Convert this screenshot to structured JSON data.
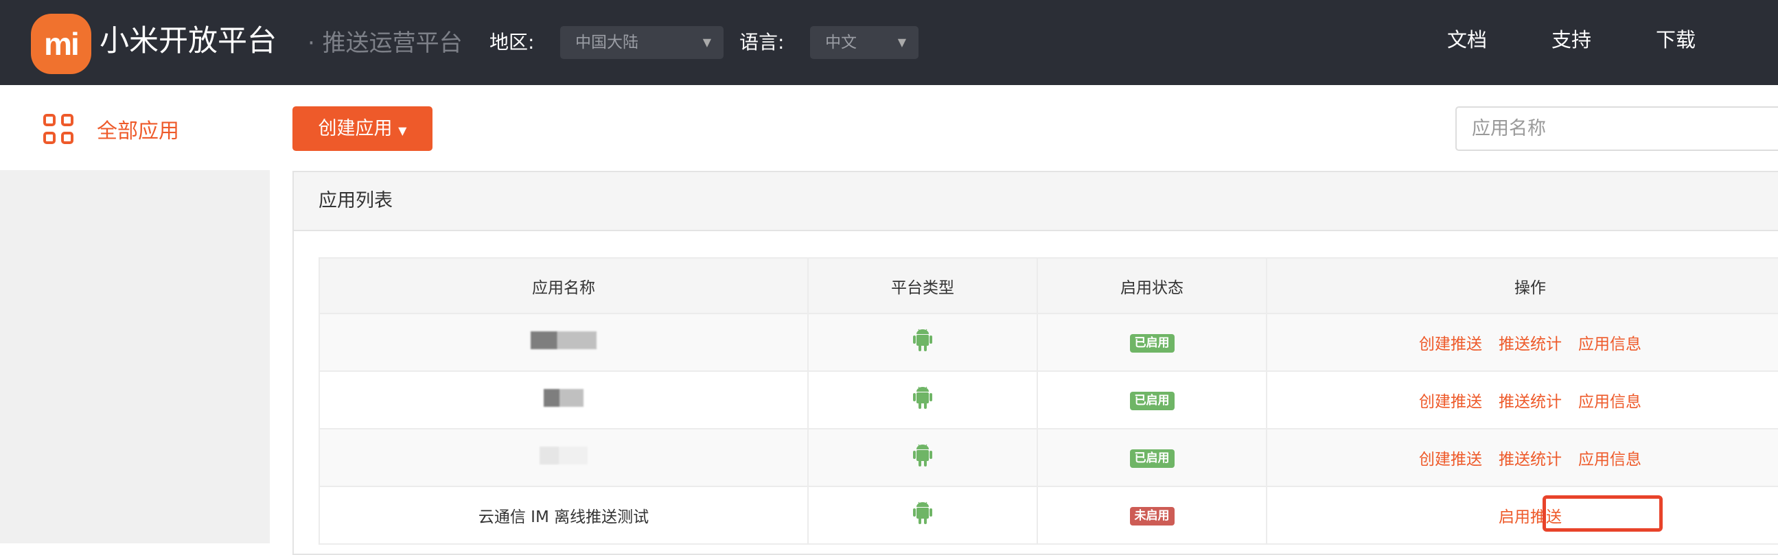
{
  "header": {
    "logo_text": "mi",
    "brand": "小米开放平台",
    "subtitle": "· 推送运营平台",
    "region_label": "地区:",
    "region_value": "中国大陆",
    "language_label": "语言:",
    "language_value": "中文",
    "nav": [
      "文档",
      "支持",
      "下载"
    ]
  },
  "sidebar": {
    "items": [
      {
        "label": "全部应用",
        "icon": "grid-icon",
        "active": true
      }
    ]
  },
  "toolbar": {
    "create_label": "创建应用",
    "search_placeholder": "应用名称"
  },
  "panel": {
    "title": "应用列表"
  },
  "table": {
    "columns": [
      "应用名称",
      "平台类型",
      "启用状态",
      "操作"
    ],
    "rows": [
      {
        "name": "",
        "redacted": true,
        "platform": "android",
        "status": "已启用",
        "actions": [
          "创建推送",
          "推送统计",
          "应用信息"
        ]
      },
      {
        "name": "",
        "redacted": true,
        "platform": "android",
        "status": "已启用",
        "actions": [
          "创建推送",
          "推送统计",
          "应用信息"
        ]
      },
      {
        "name": "",
        "redacted": true,
        "platform": "android",
        "status": "已启用",
        "actions": [
          "创建推送",
          "推送统计",
          "应用信息"
        ]
      },
      {
        "name": "云通信 IM 离线推送测试",
        "redacted": false,
        "platform": "android",
        "status": "未启用",
        "actions": [
          "启用推送"
        ]
      }
    ]
  },
  "colors": {
    "accent": "#ee5a2a",
    "header_bg": "#2b2e36",
    "enabled": "#6fb566",
    "disabled": "#cd5c55",
    "android": "#6fb566",
    "highlight": "#e8432a"
  }
}
